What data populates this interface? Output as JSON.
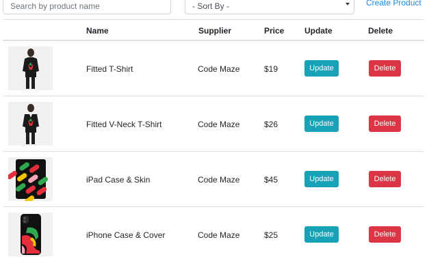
{
  "search": {
    "placeholder": "Search by product name",
    "value": ""
  },
  "sort": {
    "selected": "- Sort By -"
  },
  "create_link": "Create Product",
  "table": {
    "headers": {
      "name": "Name",
      "supplier": "Supplier",
      "price": "Price",
      "update": "Update",
      "delete": "Delete"
    },
    "rows": [
      {
        "name": "Fitted T-Shirt",
        "supplier": "Code Maze",
        "price": "$19",
        "update_label": "Update",
        "delete_label": "Delete",
        "image": "t-shirt-model"
      },
      {
        "name": "Fitted V-Neck T-Shirt",
        "supplier": "Code Maze",
        "price": "$26",
        "update_label": "Update",
        "delete_label": "Delete",
        "image": "v-neck-t-shirt-model"
      },
      {
        "name": "iPad Case & Skin",
        "supplier": "Code Maze",
        "price": "$45",
        "update_label": "Update",
        "delete_label": "Delete",
        "image": "ipad-case-pattern"
      },
      {
        "name": "iPhone Case & Cover",
        "supplier": "Code Maze",
        "price": "$25",
        "update_label": "Update",
        "delete_label": "Delete",
        "image": "iphone-case-pattern"
      }
    ]
  },
  "colors": {
    "update": "#17a2b8",
    "delete": "#dc3545",
    "link": "#1a88d8"
  }
}
